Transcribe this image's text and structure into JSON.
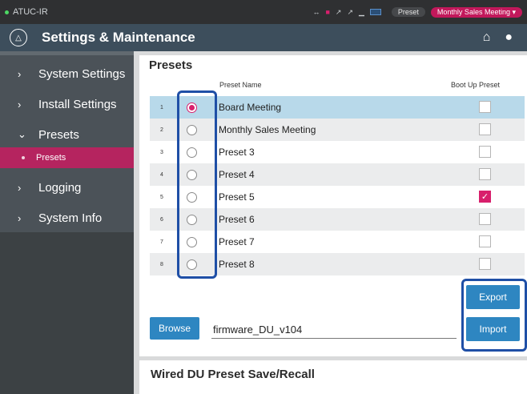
{
  "status": {
    "device": "ATUC-IR",
    "preset_label": "Preset",
    "current_preset": "Monthly Sales Meeting ▾"
  },
  "header": {
    "title": "Settings & Maintenance",
    "home_icon": "⌂",
    "user_icon": "●"
  },
  "sidebar": {
    "items": [
      {
        "label": "System Settings",
        "chevron": "›"
      },
      {
        "label": "Install Settings",
        "chevron": "›"
      },
      {
        "label": "Presets",
        "chevron": "⌄"
      },
      {
        "label": "Logging",
        "chevron": "›"
      },
      {
        "label": "System Info",
        "chevron": "›"
      }
    ],
    "sub_item": "Presets"
  },
  "presets": {
    "title": "Presets",
    "col_name": "Preset Name",
    "col_boot": "Boot Up Preset",
    "rows": [
      {
        "num": "1",
        "name": "Board Meeting",
        "selected": true,
        "boot": false
      },
      {
        "num": "2",
        "name": "Monthly Sales Meeting",
        "selected": false,
        "boot": false
      },
      {
        "num": "3",
        "name": "Preset 3",
        "selected": false,
        "boot": false
      },
      {
        "num": "4",
        "name": "Preset 4",
        "selected": false,
        "boot": false
      },
      {
        "num": "5",
        "name": "Preset 5",
        "selected": false,
        "boot": true
      },
      {
        "num": "6",
        "name": "Preset 6",
        "selected": false,
        "boot": false
      },
      {
        "num": "7",
        "name": "Preset 7",
        "selected": false,
        "boot": false
      },
      {
        "num": "8",
        "name": "Preset 8",
        "selected": false,
        "boot": false
      }
    ],
    "export_label": "Export",
    "import_label": "Import",
    "browse_label": "Browse",
    "firmware_value": "firmware_DU_v104"
  },
  "wired": {
    "title": "Wired DU Preset Save/Recall"
  },
  "colors": {
    "accent": "#d81f6c",
    "button": "#2e86c1",
    "header": "#3d4e5c",
    "highlight": "#1f4fa6"
  }
}
